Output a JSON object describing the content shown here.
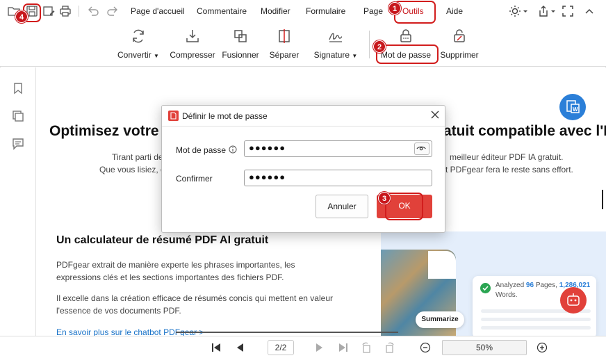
{
  "menubar": {
    "items": [
      "Page d'accueil",
      "Commentaire",
      "Modifier",
      "Formulaire",
      "Page",
      "Outils",
      "Aide"
    ]
  },
  "ribbon": {
    "tools": [
      "Convertir",
      "Compresser",
      "Fusionner",
      "Séparer",
      "Signature",
      "Mot de passe",
      "Supprimer"
    ]
  },
  "document": {
    "heading_left": "Optimisez votre",
    "heading_right": "atuit compatible avec l'I",
    "line1_left": "Tirant parti de",
    "line1_right": "meilleur éditeur PDF IA gratuit.",
    "line2_left": "Que vous lisiez, c",
    "line2_right": "t PDFgear fera le reste sans effort.",
    "section_title": "Un calculateur de résumé PDF AI gratuit",
    "para1_line1": "PDFgear extrait de manière experte les phrases importantes, les",
    "para1_line2": "expressions clés et les sections importantes des fichiers PDF.",
    "para2_line1": "Il excelle dans la création efficace de résumés concis qui mettent en valeur",
    "para2_line2": "l'essence de vos documents PDF.",
    "link": "En savoir plus sur le chatbot PDFgear >",
    "card_prefix": "Analyzed",
    "card_pages_count": "96",
    "card_pages_label": "Pages,",
    "card_words_count": "1,286,021",
    "card_words_label": "Words.",
    "summarize_button": "Summarize"
  },
  "dialog": {
    "title": "Définir le mot de passe",
    "password_label": "Mot de passe",
    "password_value": "●●●●●●",
    "confirm_label": "Confirmer",
    "confirm_value": "●●●●●●",
    "cancel_label": "Annuler",
    "ok_label": "OK"
  },
  "statusbar": {
    "page_indicator": "2/2",
    "zoom": "50%"
  },
  "badges": {
    "one": "1",
    "two": "2",
    "three": "3",
    "four": "4"
  },
  "colors": {
    "accent_red": "#e1413a",
    "annotation_red": "#c8171c",
    "link_blue": "#1a73c8",
    "pdfgear_blue": "#2b7fd8"
  }
}
